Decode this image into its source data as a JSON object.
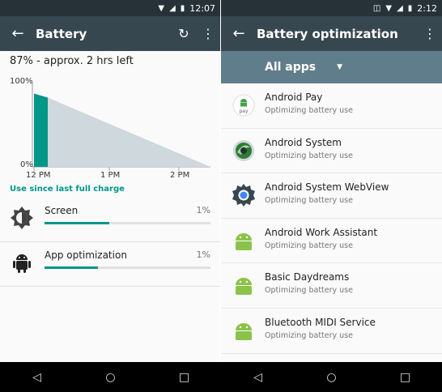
{
  "left": {
    "status": {
      "time": "12:07"
    },
    "appbar": {
      "title": "Battery",
      "back_icon": "arrow-back-icon",
      "refresh_icon": "refresh-icon",
      "menu_icon": "overflow-menu-icon"
    },
    "summary": "87% - approx. 2 hrs left",
    "graph": {
      "y_top": "100%",
      "y_bottom": "0%",
      "x_labels": [
        "12 PM",
        "1 PM",
        "2 PM"
      ],
      "level_start_percent": 87,
      "colors": {
        "history": "#009688",
        "projection": "#cfd8dc"
      }
    },
    "section_title": "Use since last full charge",
    "usage": [
      {
        "name": "Screen",
        "percent": "1%",
        "bar_fraction": 0.39,
        "icon": "brightness-icon"
      },
      {
        "name": "App optimization",
        "percent": "1%",
        "bar_fraction": 0.32,
        "icon": "android-icon"
      }
    ]
  },
  "right": {
    "status": {
      "time": "2:12"
    },
    "appbar": {
      "title": "Battery optimization",
      "back_icon": "arrow-back-icon",
      "menu_icon": "overflow-menu-icon"
    },
    "filter": {
      "label": "All apps",
      "icon": "dropdown-caret-icon"
    },
    "apps": [
      {
        "name": "Android Pay",
        "status": "Optimizing battery use",
        "icon": "android-pay-icon",
        "icon_text": "pay"
      },
      {
        "name": "Android System",
        "status": "Optimizing battery use",
        "icon": "android-system-icon"
      },
      {
        "name": "Android System WebView",
        "status": "Optimizing battery use",
        "icon": "webview-gear-icon"
      },
      {
        "name": "Android Work Assistant",
        "status": "Optimizing battery use",
        "icon": "android-icon"
      },
      {
        "name": "Basic Daydreams",
        "status": "Optimizing battery use",
        "icon": "android-icon"
      },
      {
        "name": "Bluetooth MIDI Service",
        "status": "Optimizing battery use",
        "icon": "android-icon"
      }
    ]
  },
  "navbar": {
    "back": "◁",
    "home": "○",
    "recents": "□"
  }
}
